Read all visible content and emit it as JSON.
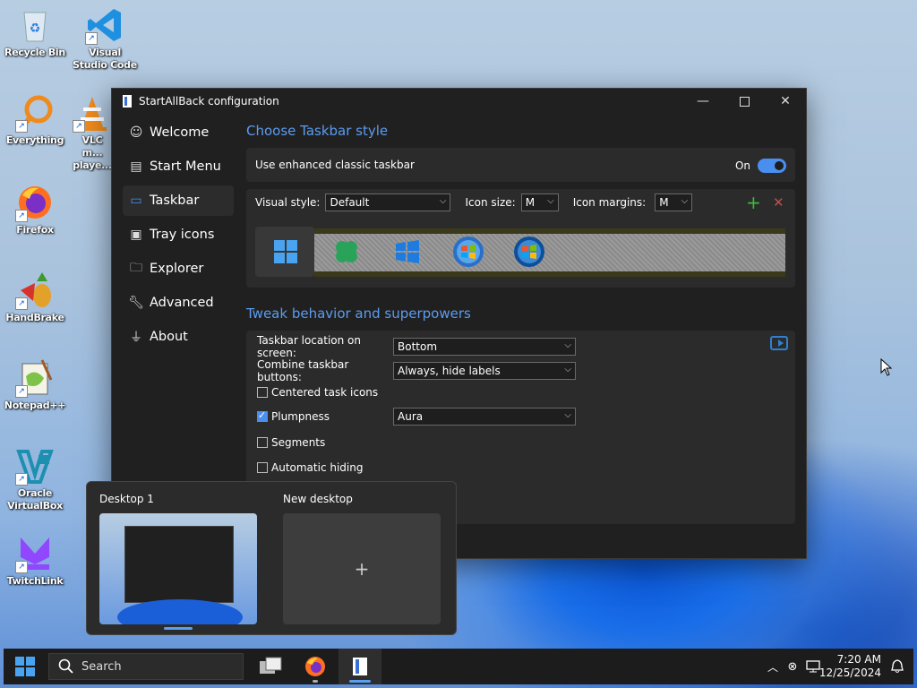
{
  "desktop": {
    "icons": [
      {
        "label": "Recycle Bin"
      },
      {
        "label": "Visual Studio Code"
      },
      {
        "label": "Everything"
      },
      {
        "label": "VLC m... playe..."
      },
      {
        "label": "Firefox"
      },
      {
        "label": "HandBrake"
      },
      {
        "label": "Notepad++"
      },
      {
        "label": "Oracle VirtualBox"
      },
      {
        "label": "TwitchLink"
      }
    ]
  },
  "window": {
    "title": "StartAllBack configuration",
    "nav": [
      {
        "label": "Welcome",
        "icon": "smile-icon"
      },
      {
        "label": "Start Menu",
        "icon": "start-menu-icon"
      },
      {
        "label": "Taskbar",
        "icon": "taskbar-icon"
      },
      {
        "label": "Tray icons",
        "icon": "tray-icon"
      },
      {
        "label": "Explorer",
        "icon": "folder-icon"
      },
      {
        "label": "Advanced",
        "icon": "wrench-icon"
      },
      {
        "label": "About",
        "icon": "about-icon"
      }
    ],
    "active_nav": "Taskbar",
    "section1_title": "Choose Taskbar style",
    "enhanced_label": "Use enhanced classic taskbar",
    "enhanced_state": "On",
    "visual_style_label": "Visual style:",
    "visual_style_value": "Default",
    "icon_size_label": "Icon size:",
    "icon_size_value": "M",
    "icon_margins_label": "Icon margins:",
    "icon_margins_value": "M",
    "section2_title": "Tweak behavior and superpowers",
    "location_label": "Taskbar location on screen:",
    "location_value": "Bottom",
    "combine_label": "Combine taskbar buttons:",
    "combine_value": "Always, hide labels",
    "centered_label": "Centered task icons",
    "centered_checked": false,
    "plumpness_label": "Plumpness",
    "plumpness_checked": true,
    "plumpness_value": "Aura",
    "segments_label": "Segments",
    "segments_checked": false,
    "autohide_label": "Automatic hiding",
    "autohide_checked": false,
    "add_symbol": "+",
    "remove_symbol": "✕"
  },
  "virtual_desktops": {
    "desktop1_label": "Desktop 1",
    "new_label": "New desktop",
    "new_symbol": "+"
  },
  "taskbar": {
    "search_label": "Search",
    "time": "7:20 AM",
    "date": "12/25/2024"
  },
  "colors": {
    "accent": "#4a8ff0",
    "section_title": "#5b9cf0",
    "window_bg": "#202020",
    "panel_bg": "#2b2b2b",
    "taskbar_bg": "#1c1c1c"
  }
}
